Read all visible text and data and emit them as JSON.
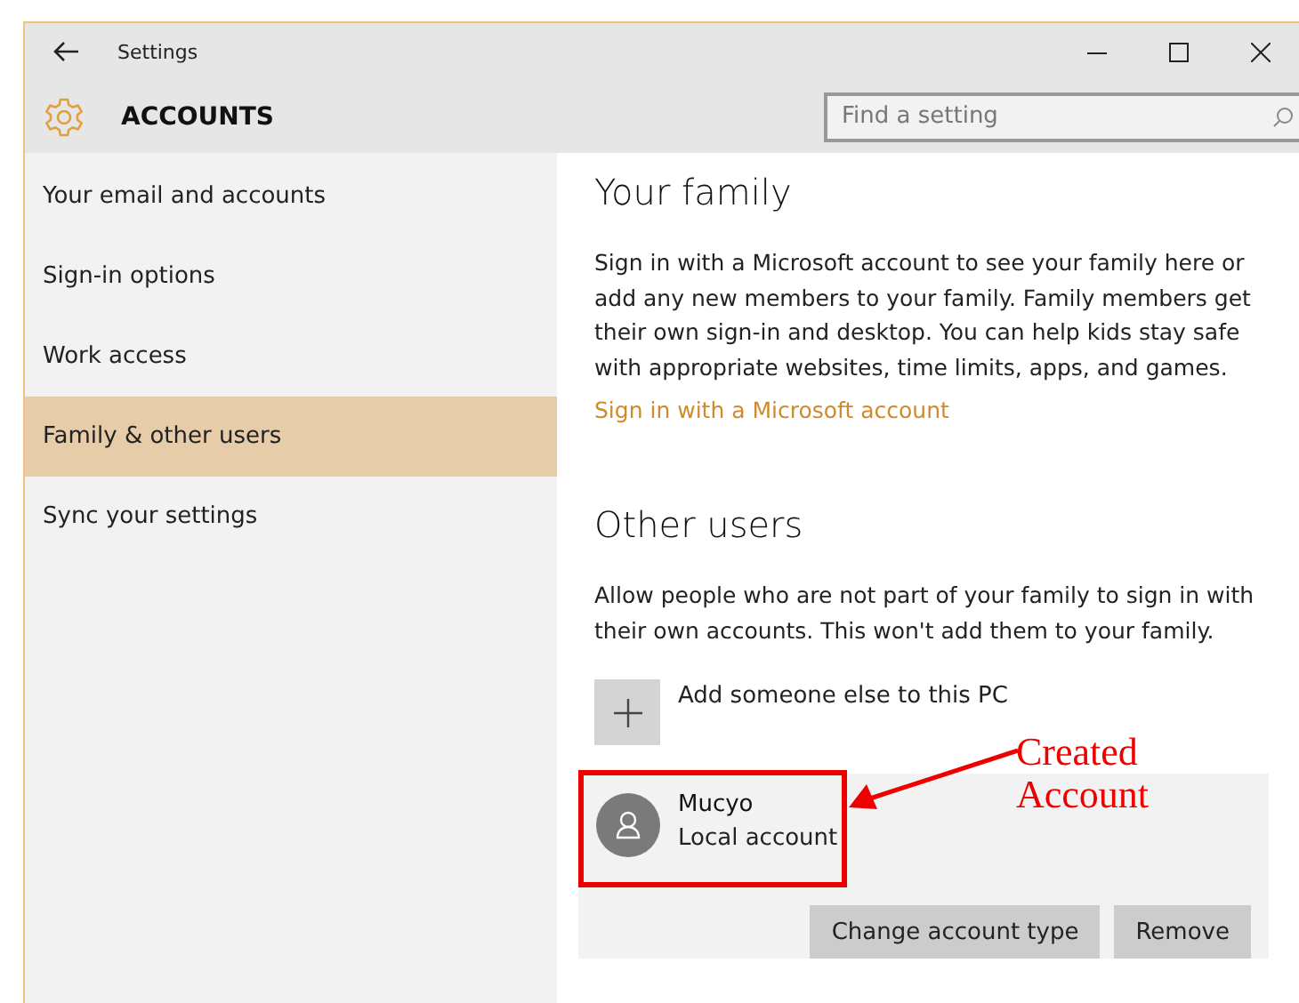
{
  "window": {
    "title": "Settings"
  },
  "header": {
    "title": "ACCOUNTS",
    "search": {
      "placeholder": "Find a setting"
    }
  },
  "sidebar": {
    "items": [
      {
        "label": "Your email and accounts",
        "selected": false
      },
      {
        "label": "Sign-in options",
        "selected": false
      },
      {
        "label": "Work access",
        "selected": false
      },
      {
        "label": "Family & other users",
        "selected": true
      },
      {
        "label": "Sync your settings",
        "selected": false
      }
    ]
  },
  "family": {
    "heading": "Your family",
    "text": "Sign in with a Microsoft account to see your family here or add any new members to your family. Family members get their own sign-in and desktop. You can help kids stay safe with appropriate websites, time limits, apps, and games.",
    "link": "Sign in with a Microsoft account"
  },
  "other_users": {
    "heading": "Other users",
    "text": "Allow people who are not part of your family to sign in with their own accounts. This won't add them to your family.",
    "add_label": "Add someone else to this PC",
    "users": [
      {
        "name": "Mucyo",
        "type": "Local account",
        "buttons": [
          "Change account type",
          "Remove"
        ]
      }
    ]
  },
  "annotation": {
    "lines": [
      "Created",
      "Account"
    ]
  }
}
